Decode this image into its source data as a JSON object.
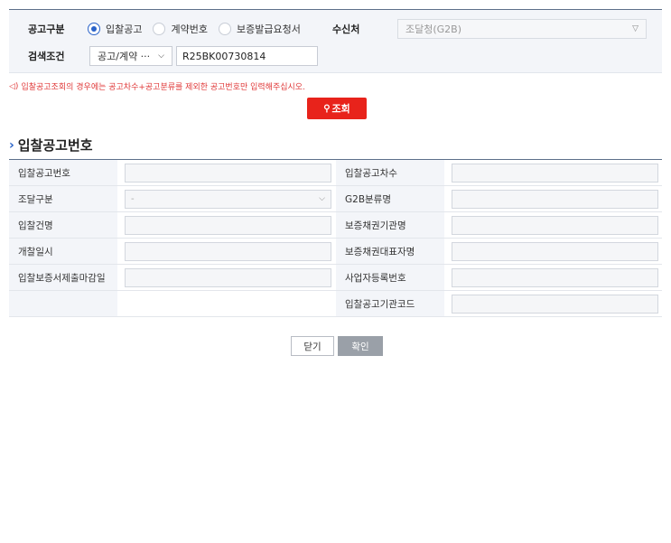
{
  "search": {
    "notice_type_label": "공고구분",
    "radios": [
      {
        "label": "입찰공고",
        "selected": true
      },
      {
        "label": "계약번호",
        "selected": false
      },
      {
        "label": "보증발급요청서",
        "selected": false
      }
    ],
    "recipient_label": "수신처",
    "recipient_value": "조달청(G2B)",
    "condition_label": "검색조건",
    "condition_select": "공고/계약 ···",
    "condition_input": "R25BK00730814",
    "notice_text": "입찰공고조회의 경우에는 공고차수+공고분류를 제외한 공고번호만 입력해주십시오.",
    "notice_icon": "speaker-icon",
    "search_button": "조회"
  },
  "section": {
    "title": "입찰공고번호"
  },
  "detail": {
    "rows": [
      {
        "left_label": "입찰공고번호",
        "left_value": "",
        "right_label": "입찰공고차수",
        "right_value": ""
      },
      {
        "left_label": "조달구분",
        "left_value": "-",
        "right_label": "G2B분류명",
        "right_value": ""
      },
      {
        "left_label": "입찰건명",
        "left_value": "",
        "right_label": "보증채권기관명",
        "right_value": ""
      },
      {
        "left_label": "개찰일시",
        "left_value": "",
        "right_label": "보증채권대표자명",
        "right_value": ""
      },
      {
        "left_label": "입찰보증서제출마감일",
        "left_value": "",
        "right_label": "사업자등록번호",
        "right_value": ""
      },
      {
        "left_label": "",
        "left_value": "",
        "right_label": "입찰공고기관코드",
        "right_value": ""
      }
    ]
  },
  "buttons": {
    "close": "닫기",
    "confirm": "확인"
  },
  "colors": {
    "accent": "#2a63c9",
    "danger": "#e8231b",
    "header_line": "#5d6f8a"
  }
}
